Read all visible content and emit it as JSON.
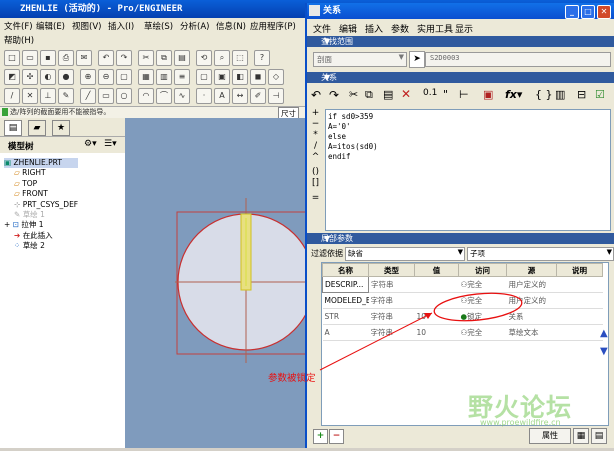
{
  "main_window": {
    "title": "ZHENLIE (活动的) - Pro/ENGINEER",
    "menus": [
      "文件(F)",
      "编辑(E)",
      "视图(V)",
      "插入(I)",
      "草绘(S)",
      "分析(A)",
      "信息(N)",
      "应用程序(P)"
    ],
    "help_menu": "帮助(H)",
    "status_message": "选/阵列的截面要用不能被指导。",
    "size_label": "尺寸",
    "model_tree_title": "模型树",
    "tree_items": [
      "ZHENLIE.PRT",
      "RIGHT",
      "TOP",
      "FRONT",
      "PRT_CSYS_DEF",
      "草绘 1",
      "拉伸 1",
      "在此插入",
      "草绘 2"
    ]
  },
  "relations_dialog": {
    "title": "关系",
    "menus": [
      "文件",
      "编辑",
      "插入",
      "参数",
      "实用工具",
      "显示"
    ],
    "lookin_section": "查找范围",
    "lookin_type": "剖面",
    "lookin_value": "S2D0003",
    "relations_section": "关系",
    "relations_text": [
      "if sd0>359",
      "A='0'",
      "else",
      "A=itos(sd0)",
      "endif"
    ],
    "local_params_section": "局部参数",
    "filter_label": "过滤依据",
    "filter_value": "缺省",
    "subitem_label": "子项",
    "columns": [
      "名称",
      "类型",
      "值",
      "访问",
      "源",
      "说明"
    ],
    "rows": [
      {
        "name": "DESCRIP...",
        "type": "字符串",
        "value": "",
        "access": "完全",
        "source": "用户定义的",
        "note": ""
      },
      {
        "name": "MODELED_BY",
        "type": "字符串",
        "value": "",
        "access": "完全",
        "source": "用户定义的",
        "note": ""
      },
      {
        "name": "STR",
        "type": "字符串",
        "value": "10",
        "access": "锁定",
        "source": "关系",
        "note": ""
      },
      {
        "name": "A",
        "type": "字符串",
        "value": "10",
        "access": "完全",
        "source": "草绘文本",
        "note": ""
      }
    ],
    "properties_button": "属性",
    "add_button": "+",
    "remove_button": "−"
  },
  "annotation": {
    "text": "参数被锁定",
    "color": "#e81010"
  },
  "watermark": {
    "text": "野火论坛",
    "url": "www.proewildfire.cn"
  }
}
